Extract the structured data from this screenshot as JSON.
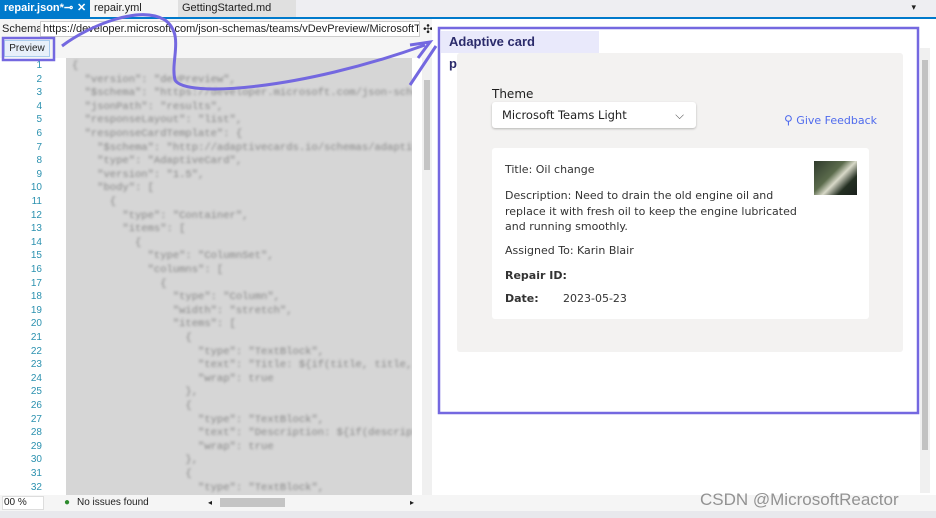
{
  "tabs": [
    {
      "label": "repair.json*",
      "active": true
    },
    {
      "label": "repair.yml"
    },
    {
      "label": "GettingStarted.md"
    }
  ],
  "schema": {
    "label": "Schema:",
    "value": "https://developer.microsoft.com/json-schemas/teams/vDevPreview/MicrosoftTeams.f"
  },
  "preview_button": "Preview",
  "editor": {
    "line_numbers": [
      "1",
      "2",
      "3",
      "4",
      "5",
      "6",
      "7",
      "8",
      "9",
      "10",
      "11",
      "12",
      "13",
      "14",
      "15",
      "16",
      "17",
      "18",
      "19",
      "20",
      "21",
      "22",
      "23",
      "24",
      "25",
      "26",
      "27",
      "28",
      "29",
      "30",
      "31",
      "32"
    ],
    "lines": [
      "{",
      "  \"version\": \"devPreview\",",
      "  \"$schema\": \"https://developer.microsoft.com/json-schem",
      "  \"jsonPath\": \"results\",",
      "  \"responseLayout\": \"list\",",
      "  \"responseCardTemplate\": {",
      "    \"$schema\": \"http://adaptivecards.io/schemas/adaptive",
      "    \"type\": \"AdaptiveCard\",",
      "    \"version\": \"1.5\",",
      "    \"body\": [",
      "      {",
      "        \"type\": \"Container\",",
      "        \"items\": [",
      "          {",
      "            \"type\": \"ColumnSet\",",
      "            \"columns\": [",
      "              {",
      "                \"type\": \"Column\",",
      "                \"width\": \"stretch\",",
      "                \"items\": [",
      "                  {",
      "                    \"type\": \"TextBlock\",",
      "                    \"text\": \"Title: ${if(title, title, 'N/A')}\",",
      "                    \"wrap\": true",
      "                  },",
      "                  {",
      "                    \"type\": \"TextBlock\",",
      "                    \"text\": \"Description: ${if(description",
      "                    \"wrap\": true",
      "                  },",
      "                  {",
      "                    \"type\": \"TextBlock\","
    ]
  },
  "previewer": {
    "heading": "Adaptive card previewer",
    "theme_label": "Theme",
    "theme_value": "Microsoft Teams Light",
    "feedback": "Give Feedback",
    "card": {
      "title": "Title: Oil change",
      "description": "Description: Need to drain the old engine oil and replace it with fresh oil to keep the engine lubricated and running smoothly.",
      "assigned": "Assigned To: Karin Blair",
      "repair_id_label": "Repair ID:",
      "date_label": "Date:",
      "date_value": "2023-05-23"
    }
  },
  "status": {
    "zoom": "00 %",
    "issues": "No issues found"
  },
  "watermark": "CSDN @MicrosoftReactor",
  "colors": {
    "accent": "#007acc",
    "annotation": "#7468e0",
    "link": "#4f6bed"
  }
}
